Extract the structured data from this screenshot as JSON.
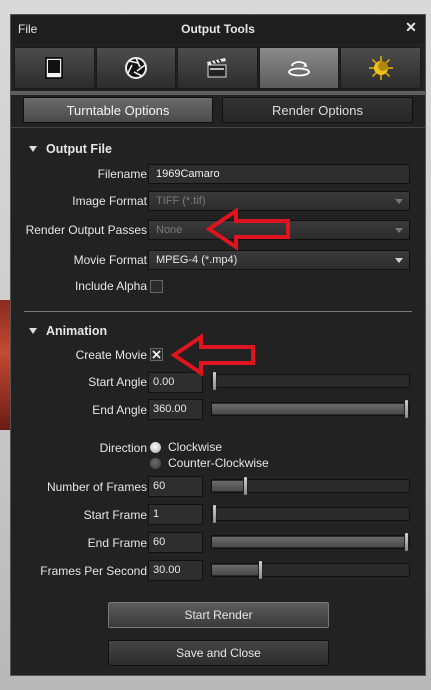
{
  "titlebar": {
    "menu_label": "File",
    "title": "Output Tools",
    "close_glyph": "✕"
  },
  "icon_tabs": [
    {
      "icon": "frame-icon",
      "active": false
    },
    {
      "icon": "aperture-icon",
      "active": false
    },
    {
      "icon": "clapperboard-icon",
      "active": false
    },
    {
      "icon": "turntable-icon",
      "active": true
    },
    {
      "icon": "sun-icon",
      "active": false
    }
  ],
  "mode_toggle": {
    "turntable_label": "Turntable Options",
    "render_label": "Render Options",
    "active": "turntable"
  },
  "output_file": {
    "section_label": "Output File",
    "filename_label": "Filename",
    "filename_value": "1969Camaro",
    "image_format_label": "Image Format",
    "image_format_value": "TIFF (*.tif)",
    "passes_label": "Render Output Passes",
    "passes_value": "None",
    "movie_format_label": "Movie Format",
    "movie_format_value": "MPEG-4 (*.mp4)",
    "alpha_label": "Include Alpha",
    "alpha_checked": false
  },
  "animation": {
    "section_label": "Animation",
    "create_movie_label": "Create Movie",
    "create_movie_checked": true,
    "start_angle_label": "Start Angle",
    "start_angle_value": "0.00",
    "start_angle_fraction": 0.0,
    "end_angle_label": "End Angle",
    "end_angle_value": "360.00",
    "end_angle_fraction": 1.0,
    "direction_label": "Direction",
    "direction_options": [
      "Clockwise",
      "Counter-Clockwise"
    ],
    "direction_selected": "Clockwise",
    "frames_label": "Number of Frames",
    "frames_value": "60",
    "frames_fraction": 0.16,
    "start_frame_label": "Start Frame",
    "start_frame_value": "1",
    "start_frame_fraction": 0.0,
    "end_frame_label": "End Frame",
    "end_frame_value": "60",
    "end_frame_fraction": 1.0,
    "fps_label": "Frames Per Second",
    "fps_value": "30.00",
    "fps_fraction": 0.24
  },
  "actions": {
    "start_render_label": "Start Render",
    "save_close_label": "Save and Close"
  },
  "colors": {
    "annotation_red": "#e0141e",
    "panel_bg": "#222222"
  }
}
